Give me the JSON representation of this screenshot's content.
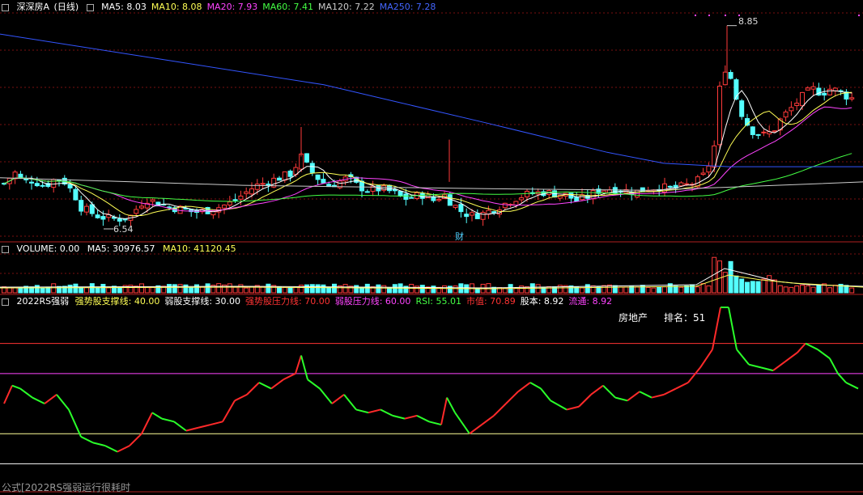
{
  "header": {
    "title": "深深房A",
    "period": "(日线)",
    "ma": [
      {
        "label": "MA5:",
        "value": "8.03",
        "color": "#ffffff"
      },
      {
        "label": "MA10:",
        "value": "8.08",
        "color": "#ffff55"
      },
      {
        "label": "MA20:",
        "value": "7.93",
        "color": "#ff44ff"
      },
      {
        "label": "MA60:",
        "value": "7.41",
        "color": "#44ff44"
      },
      {
        "label": "MA120:",
        "value": "7.22",
        "color": "#cccccc"
      },
      {
        "label": "MA250:",
        "value": "7.28",
        "color": "#4466ff"
      }
    ]
  },
  "price_panel": {
    "high_label": "8.85",
    "low_label": "6.54",
    "event_tag": "财"
  },
  "volume_panel": {
    "title": "VOLUME: 0.00",
    "ma5": "MA5: 30976.57",
    "ma10": "MA10: 41120.45"
  },
  "rsi_panel": {
    "name": "2022RS强弱",
    "items": [
      {
        "text": "强势股支撑线: 40.00",
        "color": "#ffff55"
      },
      {
        "text": "弱股支撑线: 30.00",
        "color": "#ffffff"
      },
      {
        "text": "强势股压力线: 70.00",
        "color": "#ff3333"
      },
      {
        "text": "弱股压力线: 60.00",
        "color": "#ff44ff"
      },
      {
        "text": "RSI: 55.01",
        "color": "#44ff44"
      },
      {
        "text": "市值: 70.89",
        "color": "#ff3333"
      },
      {
        "text": "股本: 8.92",
        "color": "#ffffff"
      },
      {
        "text": "流通: 8.92",
        "color": "#ff44ff"
      }
    ],
    "sector": "房地产",
    "rank": "排名：51"
  },
  "footer": "公式[2022RS强弱运行很耗时",
  "chart_data": [
    {
      "type": "candlestick",
      "title": "深深房A (日线)",
      "price_range": [
        6.3,
        9.0
      ],
      "ma_lines": [
        "MA5",
        "MA10",
        "MA20",
        "MA60",
        "MA120",
        "MA250"
      ],
      "annotations": [
        {
          "text": "8.85",
          "type": "high"
        },
        {
          "text": "6.54",
          "type": "low"
        }
      ]
    },
    {
      "type": "bar",
      "title": "VOLUME",
      "series": [
        {
          "name": "MA5",
          "value": 30976.57
        },
        {
          "name": "MA10",
          "value": 41120.45
        }
      ]
    },
    {
      "type": "line",
      "title": "2022RS强弱",
      "reference_lines": [
        {
          "name": "强势股支撑线",
          "value": 40
        },
        {
          "name": "弱股支撑线",
          "value": 30
        },
        {
          "name": "强势股压力线",
          "value": 70
        },
        {
          "name": "弱股压力线",
          "value": 60
        }
      ],
      "series": [
        {
          "name": "RSI",
          "last": 55.01
        }
      ],
      "ylim": [
        25,
        82
      ]
    }
  ]
}
